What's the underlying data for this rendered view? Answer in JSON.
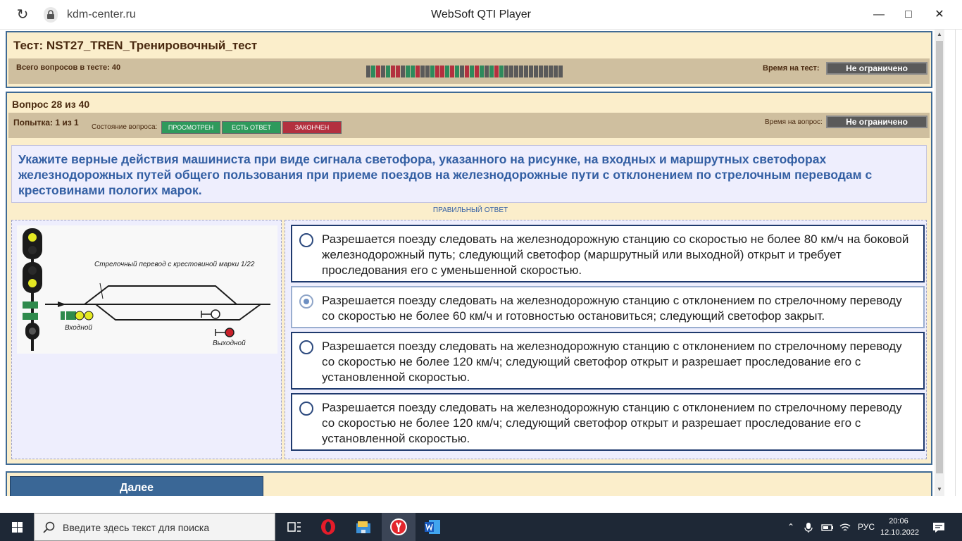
{
  "browser": {
    "domain": "kdm-center.ru",
    "window_title": "WebSoft QTI Player",
    "minimize_icon": "minimize-icon",
    "maximize_icon": "maximize-icon",
    "close_icon": "close-icon"
  },
  "test": {
    "title": "Тест: NST27_TREN_Тренировочный_тест",
    "total_label": "Всего вопросов в тесте: 40",
    "time_label": "Время на тест:",
    "time_value": "Не ограничено",
    "progress_total": 40,
    "progress_cells": [
      "#5a5a5a",
      "#2e8a5c",
      "#b3303f",
      "#5a5a5a",
      "#2e8a5c",
      "#b3303f",
      "#b3303f",
      "#5a5a5a",
      "#2e8a5c",
      "#2e8a5c",
      "#b3303f",
      "#5a5a5a",
      "#5a5a5a",
      "#2e8a5c",
      "#b3303f",
      "#b3303f",
      "#2e8a5c",
      "#b3303f",
      "#2e8a5c",
      "#5a5a5a",
      "#b3303f",
      "#2e8a5c",
      "#b3303f",
      "#2e8a5c",
      "#5a5a5a",
      "#2e8a5c",
      "#b3303f",
      "#2e8a5c",
      "#5a5a5a",
      "#5a5a5a",
      "#5a5a5a",
      "#5a5a5a",
      "#5a5a5a",
      "#5a5a5a",
      "#5a5a5a",
      "#5a5a5a",
      "#5a5a5a",
      "#5a5a5a",
      "#5a5a5a",
      "#5a5a5a"
    ]
  },
  "question": {
    "heading": "Вопрос 28 из 40",
    "attempt": "Попытка: 1 из 1",
    "state_label": "Состояние вопроса:",
    "state_badges": [
      "ПРОСМОТРЕН",
      "ЕСТЬ ОТВЕТ",
      "ЗАКОНЧЕН"
    ],
    "time_label": "Время на вопрос:",
    "time_value": "Не ограничено",
    "text": "Укажите верные действия машиниста при виде сигнала светофора, указанного на рисунке, на входных и маршрутных светофорах железнодорожных путей общего пользования при приеме поездов на железнодорожные пути с отклонением по стрелочным переводам с крестовинами пологих марок.",
    "correct_answer_label": "ПРАВИЛЬНЫЙ ОТВЕТ",
    "diagram": {
      "switch_label": "Стрелочный перевод с крестовиной марки 1/22",
      "entry_label": "Входной",
      "exit_label": "Выходной"
    },
    "options": [
      {
        "text": "Разрешается поезду следовать на железнодорожную станцию со скоростью не более 80 км/ч на боковой железнодорожный путь; следующий светофор (маршрутный или выходной) открыт и требует проследования его с уменьшенной скоростью.",
        "selected": false
      },
      {
        "text": "Разрешается поезду следовать на железнодорожную станцию с отклонением по стрелочному переводу со скоростью не более 60 км/ч и готовностью остановиться; следующий светофор закрыт.",
        "selected": true
      },
      {
        "text": "Разрешается поезду следовать на железнодорожную станцию с отклонением по стрелочному переводу со скоростью не более 120 км/ч; следующий светофор открыт и разрешает проследование его с установленной скоростью.",
        "selected": false
      },
      {
        "text": "Разрешается поезду следовать на железнодорожную станцию с отклонением по стрелочному переводу со скоростью не более 120 км/ч; следующий светофор открыт и разрешает проследование его с установленной скоростью.",
        "selected": false
      }
    ]
  },
  "nav": {
    "next_label": "Далее"
  },
  "taskbar": {
    "search_placeholder": "Введите здесь текст для поиска",
    "lang": "РУС",
    "time": "20:06",
    "date": "12.10.2022"
  }
}
